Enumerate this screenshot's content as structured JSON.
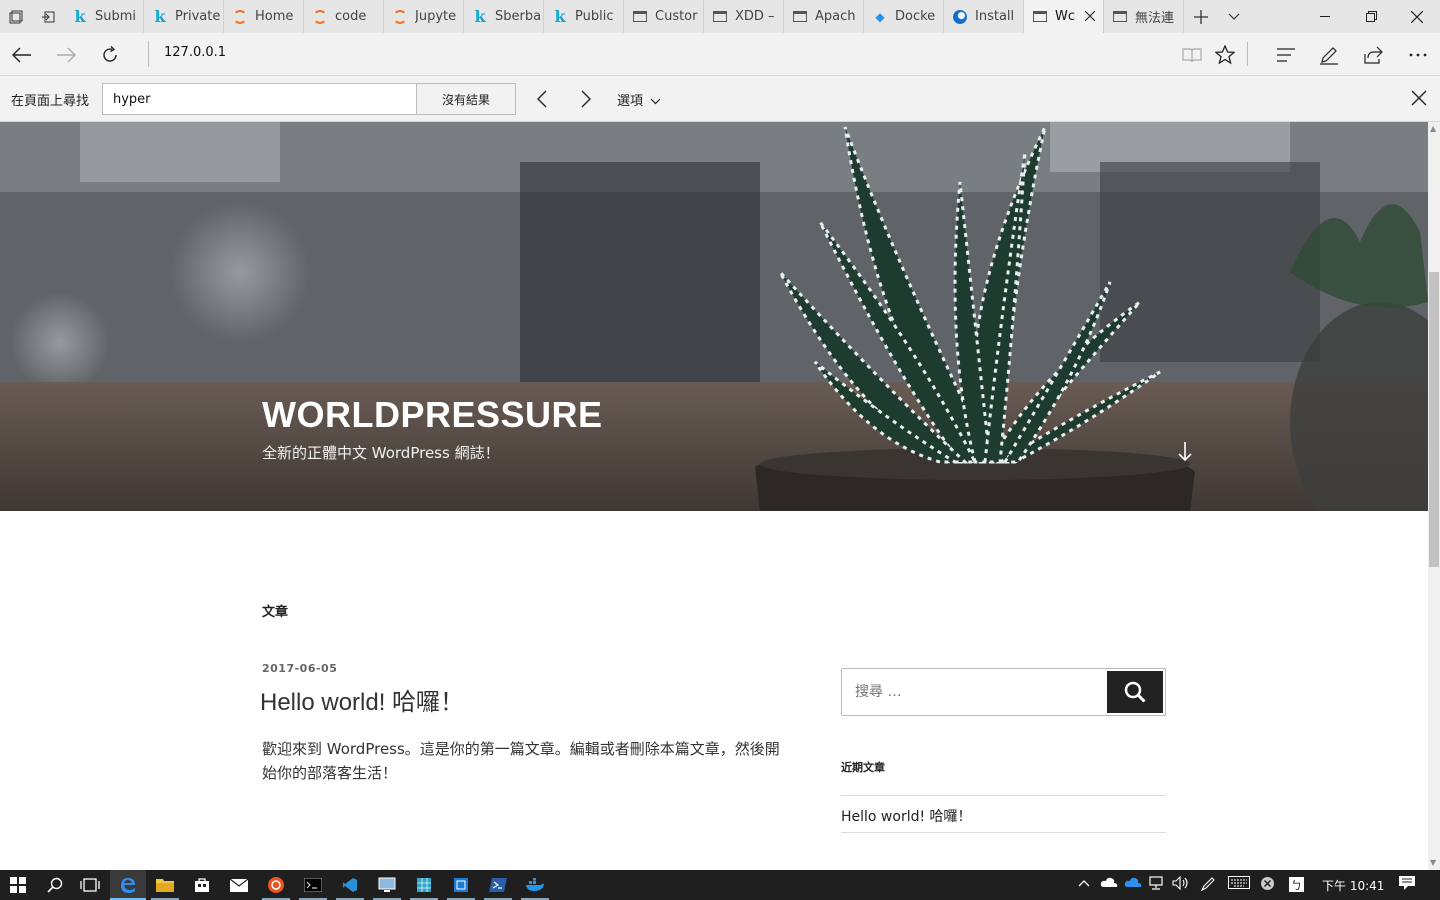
{
  "window": {
    "tabs": [
      {
        "label": "Submi",
        "icon": "kaggle-icon",
        "name": "tab-submissions"
      },
      {
        "label": "Private",
        "icon": "kaggle-icon",
        "name": "tab-private"
      },
      {
        "label": "Home",
        "icon": "jupyter-icon",
        "name": "tab-home"
      },
      {
        "label": "code",
        "icon": "jupyter-icon",
        "name": "tab-code"
      },
      {
        "label": "Jupyte",
        "icon": "jupyter-icon",
        "name": "tab-jupyter"
      },
      {
        "label": "Sberba",
        "icon": "kaggle-icon",
        "name": "tab-sberbank"
      },
      {
        "label": "Public",
        "icon": "kaggle-icon",
        "name": "tab-public"
      },
      {
        "label": "Custor",
        "icon": "page-icon",
        "name": "tab-custom"
      },
      {
        "label": "XDD –",
        "icon": "page-icon",
        "name": "tab-xdd"
      },
      {
        "label": "Apach",
        "icon": "page-icon",
        "name": "tab-apache"
      },
      {
        "label": "Docke",
        "icon": "docker-icon",
        "name": "tab-docker"
      },
      {
        "label": "Install",
        "icon": "edge-icon",
        "name": "tab-install"
      },
      {
        "label": "Wc",
        "icon": "page-icon",
        "name": "tab-wordpress",
        "active": true
      },
      {
        "label": "無法連",
        "icon": "page-icon",
        "name": "tab-unreachable"
      }
    ]
  },
  "address_bar": {
    "url": "127.0.0.1"
  },
  "find_bar": {
    "label": "在頁面上尋找",
    "query": "hyper",
    "results": "沒有結果",
    "options": "選項"
  },
  "page": {
    "site_title": "WORLDPRESSURE",
    "site_description": "全新的正體中文 WordPress 網誌！",
    "section_label": "文章",
    "post": {
      "date": "2017-06-05",
      "title": "Hello world! 哈囉！",
      "body": "歡迎來到 WordPress。這是你的第一篇文章。編輯或者刪除本篇文章，然後開始你的部落客生活！"
    },
    "sidebar": {
      "search_placeholder": "搜尋 …",
      "recent_label": "近期文章",
      "recent_posts": [
        "Hello world! 哈囉！"
      ]
    }
  },
  "taskbar": {
    "clock": "下午 10:41",
    "ime": "ㄅ"
  },
  "colors": {
    "tabbar_bg": "#e6e6e6",
    "toolbar_bg": "#f2f2f2",
    "taskbar_bg": "#1f1f1f",
    "edge_blue": "#0f6fd0",
    "search_button": "#222222"
  }
}
